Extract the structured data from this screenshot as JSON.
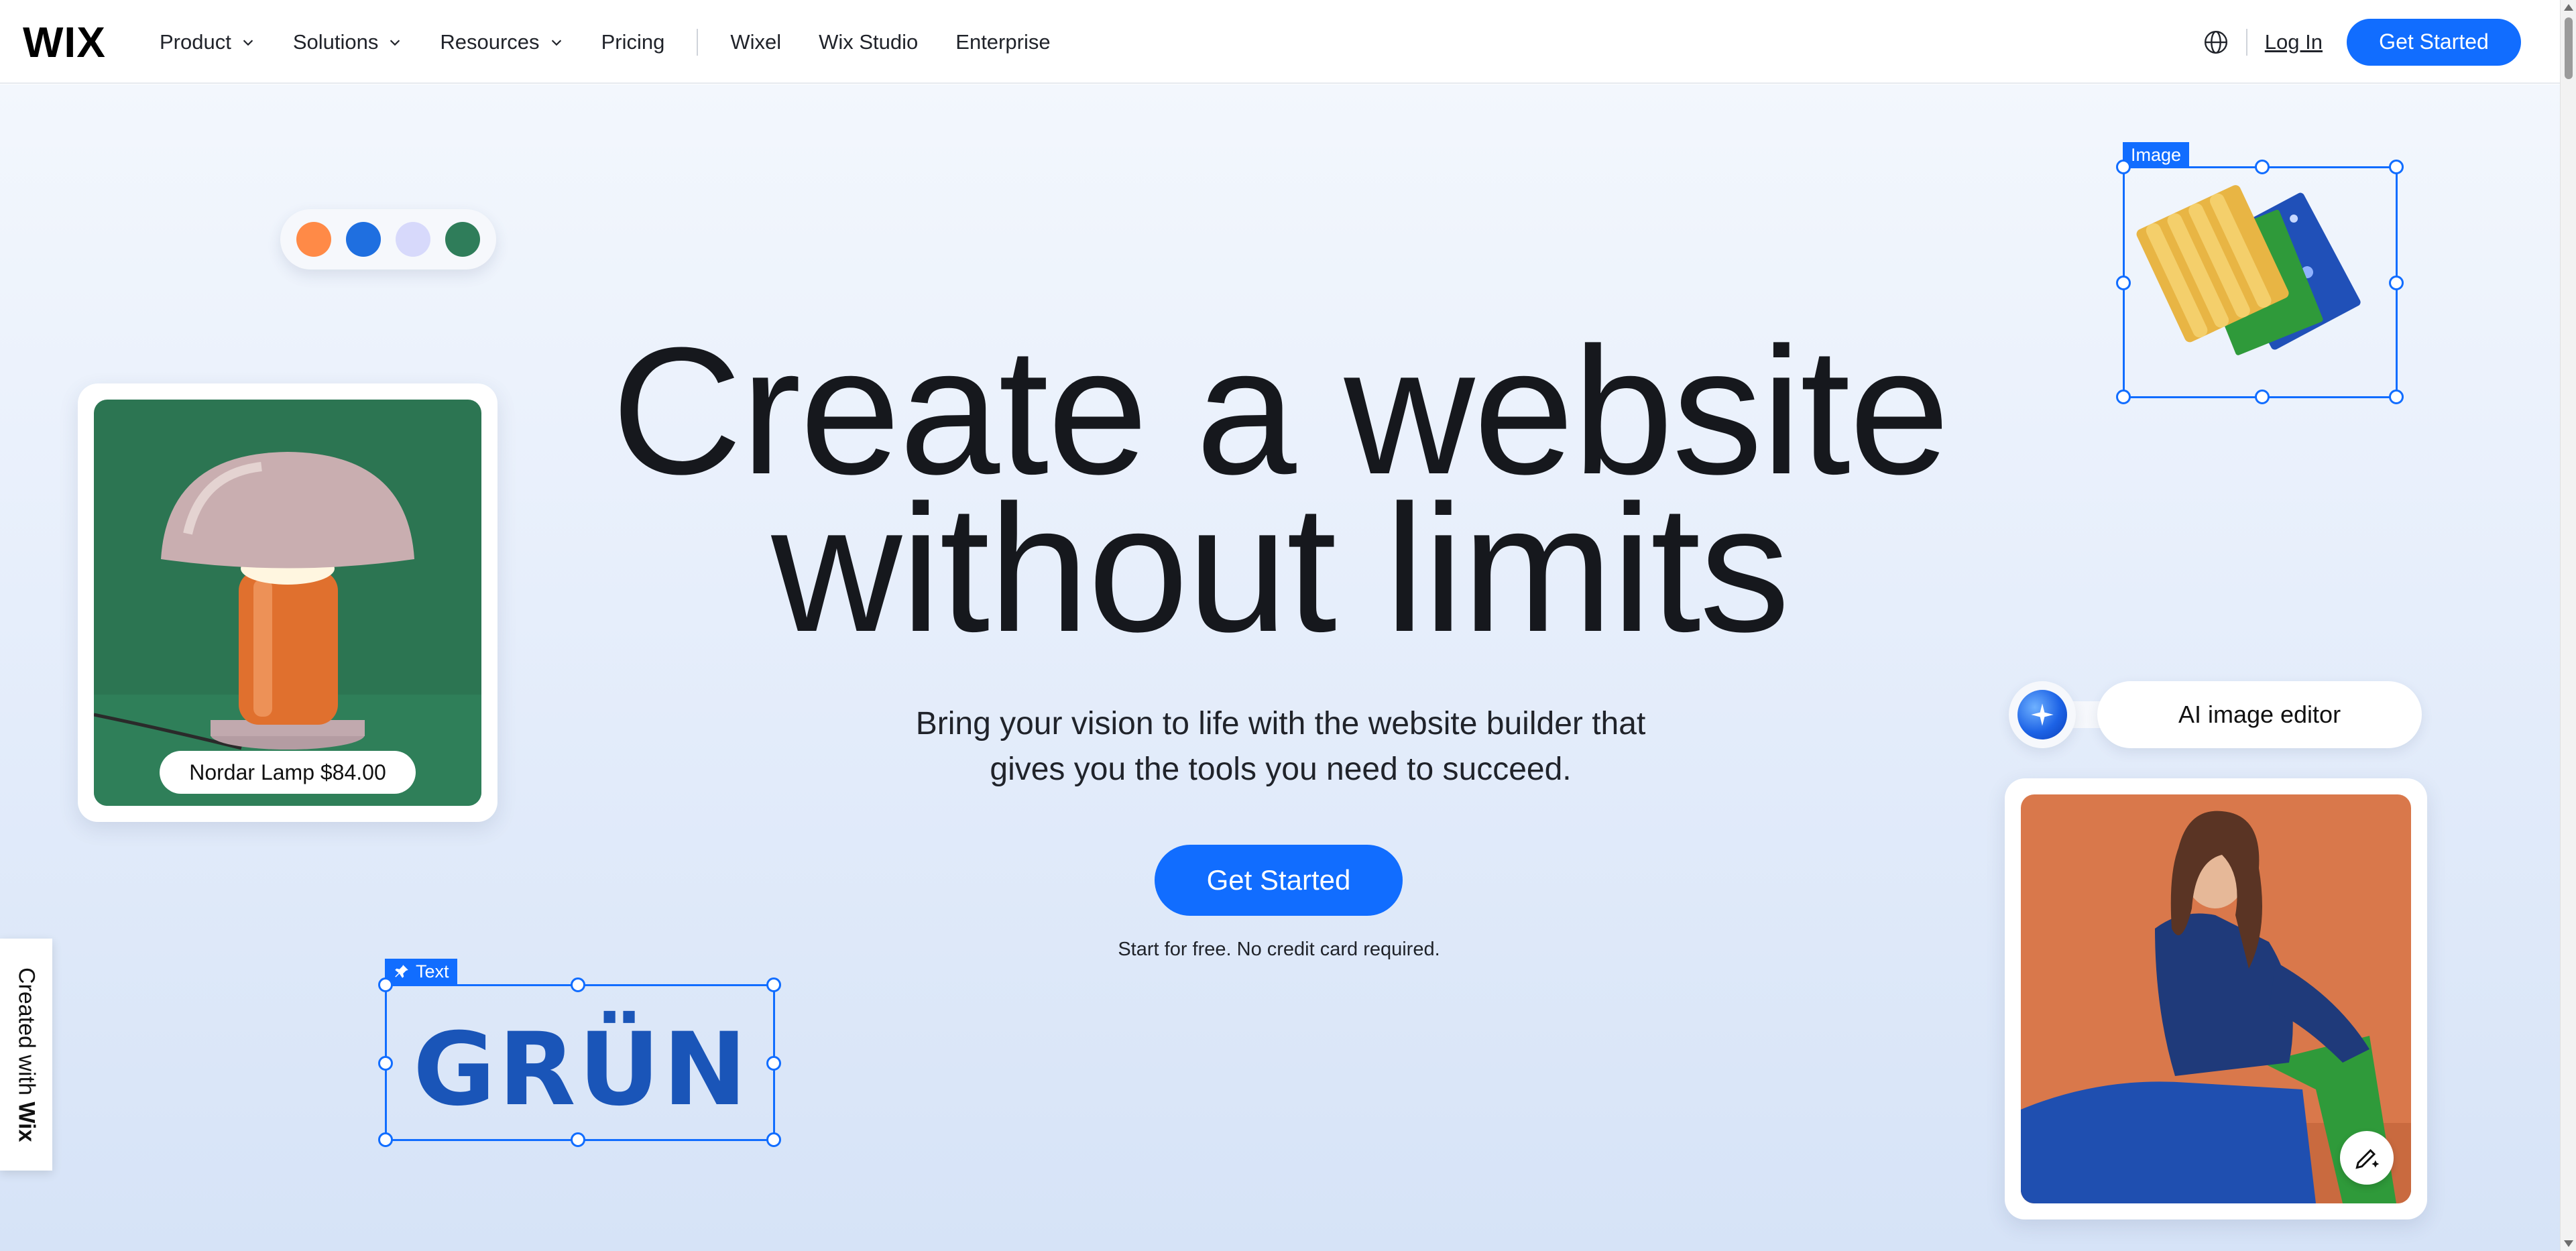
{
  "nav": {
    "logo": "WIX",
    "items": [
      {
        "label": "Product",
        "dropdown": true
      },
      {
        "label": "Solutions",
        "dropdown": true
      },
      {
        "label": "Resources",
        "dropdown": true
      },
      {
        "label": "Pricing",
        "dropdown": false
      }
    ],
    "secondary_items": [
      {
        "label": "Wixel"
      },
      {
        "label": "Wix Studio"
      },
      {
        "label": "Enterprise"
      }
    ],
    "login": "Log In",
    "cta": "Get Started",
    "language_icon": "globe-icon"
  },
  "hero": {
    "headline_line1": "Create a website",
    "headline_line2": "without limits",
    "subhead_line1": "Bring your vision to life with the website builder that",
    "subhead_line2": "gives you the tools you need to succeed.",
    "cta": "Get Started",
    "note": "Start for free. No credit card required."
  },
  "color_swatches": [
    "#ff8a47",
    "#1f6fe0",
    "#d7d9fb",
    "#2f7d5a"
  ],
  "product_card": {
    "price_label": "Nordar Lamp $84.00"
  },
  "image_widget": {
    "label": "Image"
  },
  "text_widget": {
    "label": "Text",
    "logo_text": "GRÜN"
  },
  "ai_editor": {
    "label": "AI image editor"
  },
  "created_with": {
    "prefix": "Created with ",
    "brand": "Wix"
  },
  "colors": {
    "accent": "#116dff",
    "headline": "#16181d"
  }
}
